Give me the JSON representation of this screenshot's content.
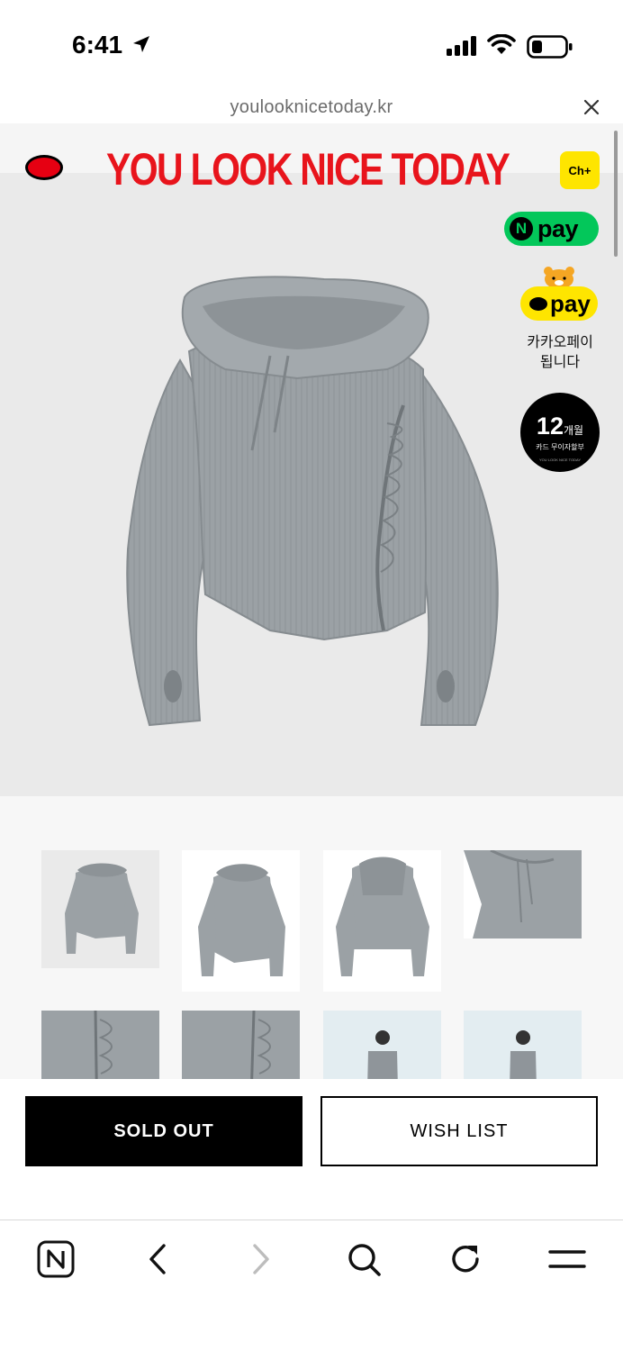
{
  "status_bar": {
    "time": "6:41"
  },
  "browser": {
    "url": "youlooknicetoday.kr"
  },
  "brand": {
    "name": "YOU LOOK NICE TODAY"
  },
  "payments": {
    "channel_label": "Ch+",
    "npay_badge": "N",
    "npay_label": "pay",
    "kakaopay_label": "pay",
    "kakaopay_caption_line1": "카카오페이",
    "kakaopay_caption_line2": "됩니다",
    "installment_number": "12",
    "installment_unit": "개월",
    "installment_sub": "카드 무이자할부",
    "installment_tiny": "YOU LOOK NICE TODAY"
  },
  "actions": {
    "sold_out_label": "SOLD OUT",
    "wish_list_label": "WISH LIST"
  },
  "thumbnails": [
    "front-flat",
    "front-flat-alt",
    "back-flat",
    "neck-detail",
    "zipper-detail",
    "ruching-detail",
    "model-front",
    "model-angle"
  ],
  "colors": {
    "brand_red": "#e8141c",
    "npay_green": "#03c75a",
    "kakao_yellow": "#fee500",
    "garment_gray": "#9aa0a4"
  },
  "toolbar": {
    "items": [
      "naver-icon",
      "back-icon",
      "forward-icon",
      "search-icon",
      "refresh-icon",
      "menu-icon"
    ]
  }
}
